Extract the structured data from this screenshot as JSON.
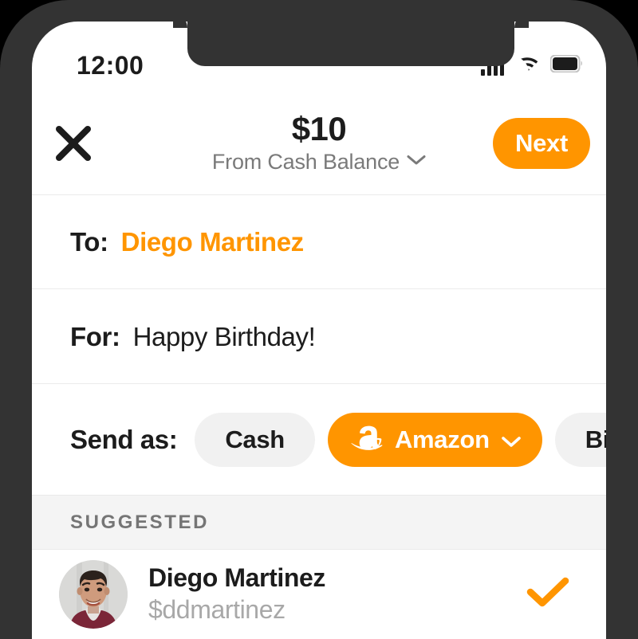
{
  "status_bar": {
    "time": "12:00",
    "icons": [
      "cellular-signal-icon",
      "wifi-icon",
      "battery-icon"
    ]
  },
  "header": {
    "close_icon": "close-icon",
    "amount": "$10",
    "source": "From Cash Balance",
    "source_chevron_icon": "chevron-down-icon",
    "next_label": "Next"
  },
  "fields": {
    "to_label": "To:",
    "to_value": "Diego Martinez",
    "for_label": "For:",
    "for_value": "Happy Birthday!"
  },
  "send_as": {
    "label": "Send as:",
    "options": [
      {
        "label": "Cash",
        "selected": false,
        "icon": null,
        "chevron": false
      },
      {
        "label": "Amazon",
        "selected": true,
        "icon": "amazon-logo-icon",
        "chevron": true
      },
      {
        "label": "Bitcoin",
        "selected": false,
        "icon": null,
        "chevron": false
      }
    ]
  },
  "suggested": {
    "section_title": "SUGGESTED",
    "contacts": [
      {
        "name": "Diego Martinez",
        "handle": "$ddmartinez",
        "avatar": "contact-photo",
        "selected": true,
        "check_icon": "check-icon"
      }
    ]
  },
  "colors": {
    "accent": "#ff9500",
    "text_primary": "#1c1c1c",
    "text_muted": "#7a7a7a",
    "chip_bg": "#f1f1f1",
    "section_bg": "#f4f4f4",
    "frame": "#333333"
  }
}
